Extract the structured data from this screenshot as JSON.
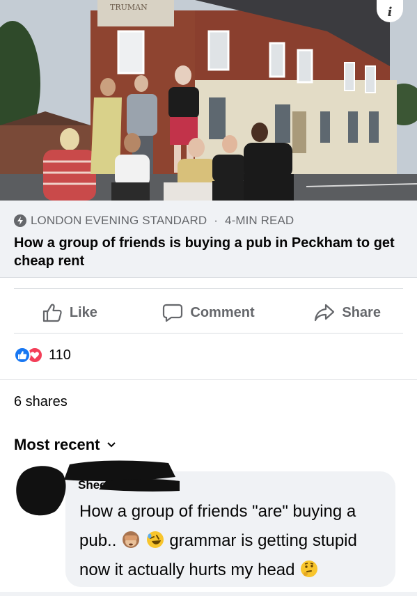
{
  "photo": {
    "sign_text": "TRUMAN",
    "info_label": "i"
  },
  "link_preview": {
    "source": "LONDON EVENING STANDARD",
    "dot": "·",
    "read_time": "4-MIN READ",
    "headline": "How a group of friends is buying a pub in Peckham to get cheap rent"
  },
  "actions": {
    "like": "Like",
    "comment": "Comment",
    "share": "Share"
  },
  "reactions": {
    "count": "110",
    "like_color": "#1877f2",
    "love_color": "#f33e58"
  },
  "shares": "6 shares",
  "sort_label": "Most recent",
  "comment": {
    "author": "Sheena Clark",
    "line1": "How a group of friends \"are\" buying a",
    "line2_a": "pub..",
    "line2_b": "grammar is getting stupid",
    "line3": "now it actually hurts my head",
    "emoji_1": "see-no-evil-monkey",
    "emoji_2": "rolling-on-floor-laughing",
    "emoji_3": "thinking-face"
  }
}
